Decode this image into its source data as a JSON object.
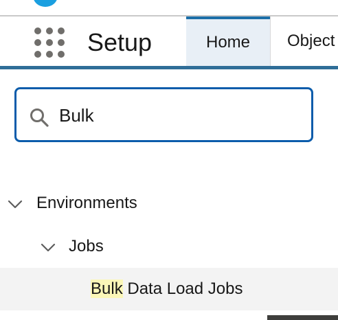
{
  "header": {
    "app_title": "Setup",
    "app_launcher_icon": "app-launcher-grid-icon",
    "tabs": [
      {
        "label": "Home",
        "active": true
      },
      {
        "label": "Object",
        "active": false
      }
    ]
  },
  "search": {
    "icon": "search-icon",
    "value": "Bulk"
  },
  "tree": {
    "environments": {
      "label": "Environments",
      "expanded": true
    },
    "jobs": {
      "label": "Jobs",
      "expanded": true
    },
    "bulk_data_load_jobs": {
      "highlight": "Bulk",
      "rest": " Data Load Jobs",
      "selected": true
    }
  },
  "colors": {
    "header_bottom_border": "#2f6e98",
    "active_tab_bg": "#e8eff6",
    "search_border": "#0b5cab",
    "search_highlight": "#fbf7b8",
    "selected_row_bg": "#f3f3f3"
  }
}
